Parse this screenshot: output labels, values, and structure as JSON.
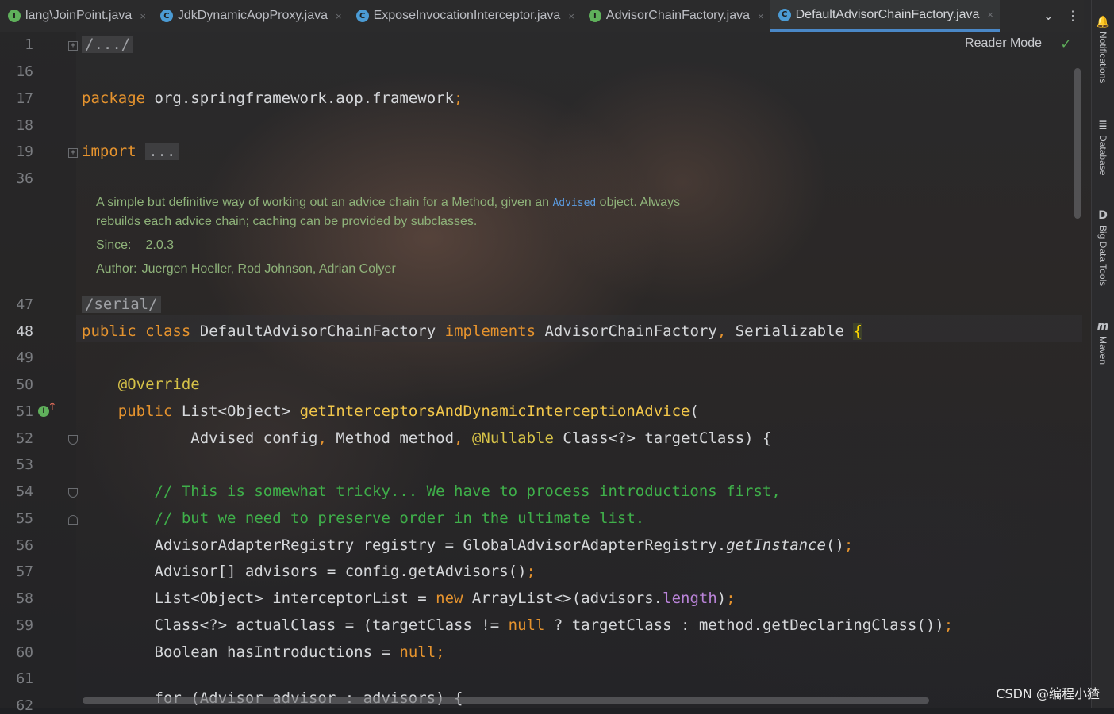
{
  "tabs": [
    {
      "label": "lang\\JoinPoint.java",
      "icon": "I",
      "kind": "interface"
    },
    {
      "label": "JdkDynamicAopProxy.java",
      "icon": "C",
      "kind": "class"
    },
    {
      "label": "ExposeInvocationInterceptor.java",
      "icon": "C",
      "kind": "class"
    },
    {
      "label": "AdvisorChainFactory.java",
      "icon": "I",
      "kind": "interface"
    },
    {
      "label": "DefaultAdvisorChainFactory.java",
      "icon": "C",
      "kind": "class",
      "active": true
    }
  ],
  "tab_actions": {
    "dropdown_icon": "⌄",
    "more_icon": "⋮"
  },
  "close_glyph": "×",
  "tool_windows": [
    {
      "label": "Notifications",
      "icon": "bell-icon",
      "glyph": "🔔"
    },
    {
      "label": "Database",
      "icon": "database-icon",
      "glyph": "≣"
    },
    {
      "label": "Big Data Tools",
      "icon": "big-data-tools-icon",
      "glyph": "D"
    },
    {
      "label": "Maven",
      "icon": "maven-icon",
      "glyph": "m"
    }
  ],
  "editor": {
    "reader_mode": "Reader Mode",
    "check_glyph": "✓",
    "current_line": "48",
    "line_numbers": [
      "1",
      "16",
      "17",
      "18",
      "19",
      "36",
      "47",
      "48",
      "49",
      "50",
      "51",
      "52",
      "53",
      "54",
      "55",
      "56",
      "57",
      "58",
      "59",
      "60",
      "61",
      "62"
    ],
    "header": {
      "folded_path": "/.../"
    },
    "package_stmt": {
      "keyword": "package",
      "name": "org.springframework.aop.framework",
      "semi": ";"
    },
    "import_stmt": {
      "keyword": "import",
      "folded": "..."
    },
    "javadoc": {
      "line1_before": "A simple but definitive way of working out an advice chain for a Method, given an ",
      "code": "Advised",
      "line1_after": " object. Always",
      "line2": "rebuilds each advice chain; caching can be provided by subclasses.",
      "since_label": "Since:",
      "since_value": "2.0.3",
      "author_label": "Author:",
      "author_value": "Juergen Hoeller, Rod Johnson, Adrian Colyer"
    },
    "serial": "/serial/",
    "class_decl": {
      "public": "public",
      "class": "class",
      "name": "DefaultAdvisorChainFactory",
      "implements": "implements",
      "iface1": "AdvisorChainFactory",
      "comma": ",",
      "iface2": "Serializable",
      "brace": "{"
    },
    "override": "@Override",
    "method_decl": {
      "public": "public",
      "ret": "List<Object>",
      "name": "getInterceptorsAndDynamicInterceptionAdvice",
      "paren": "("
    },
    "params": {
      "p1": "Advised config",
      "c1": ",",
      "p2": "Method method",
      "c2": ",",
      "nullable": "@Nullable",
      "p3": "Class<?> targetClass) {"
    },
    "comment1": "// This is somewhat tricky... We have to process introductions first,",
    "comment2": "// but we need to preserve order in the ultimate list.",
    "line56": {
      "a": "AdvisorAdapterRegistry registry = GlobalAdvisorAdapterRegistry.",
      "b": "getInstance",
      "c": "()",
      "d": ";"
    },
    "line57": {
      "a": "Advisor[] advisors = config.getAdvisors()",
      "b": ";"
    },
    "line58": {
      "a": "List<Object> interceptorList = ",
      "new": "new",
      "b": " ArrayList<>(advisors.",
      "field": "length",
      "c": ")",
      "d": ";"
    },
    "line59": {
      "a": "Class<?> actualClass = (targetClass != ",
      "null": "null",
      "b": " ? targetClass : method.getDeclaringClass())",
      "d": ";"
    },
    "line60": {
      "a": "Boolean hasIntroductions = ",
      "null": "null",
      "d": ";"
    },
    "line62": {
      "a": "for (Advisor advisor : advisors) {"
    }
  },
  "watermark": "CSDN @编程小猹",
  "colors": {
    "keyword": "#e5932e",
    "method": "#f1c64a",
    "comment": "#3fb04a",
    "annotation": "#d6c248",
    "field": "#b983d8",
    "accent": "#4a88c7"
  }
}
